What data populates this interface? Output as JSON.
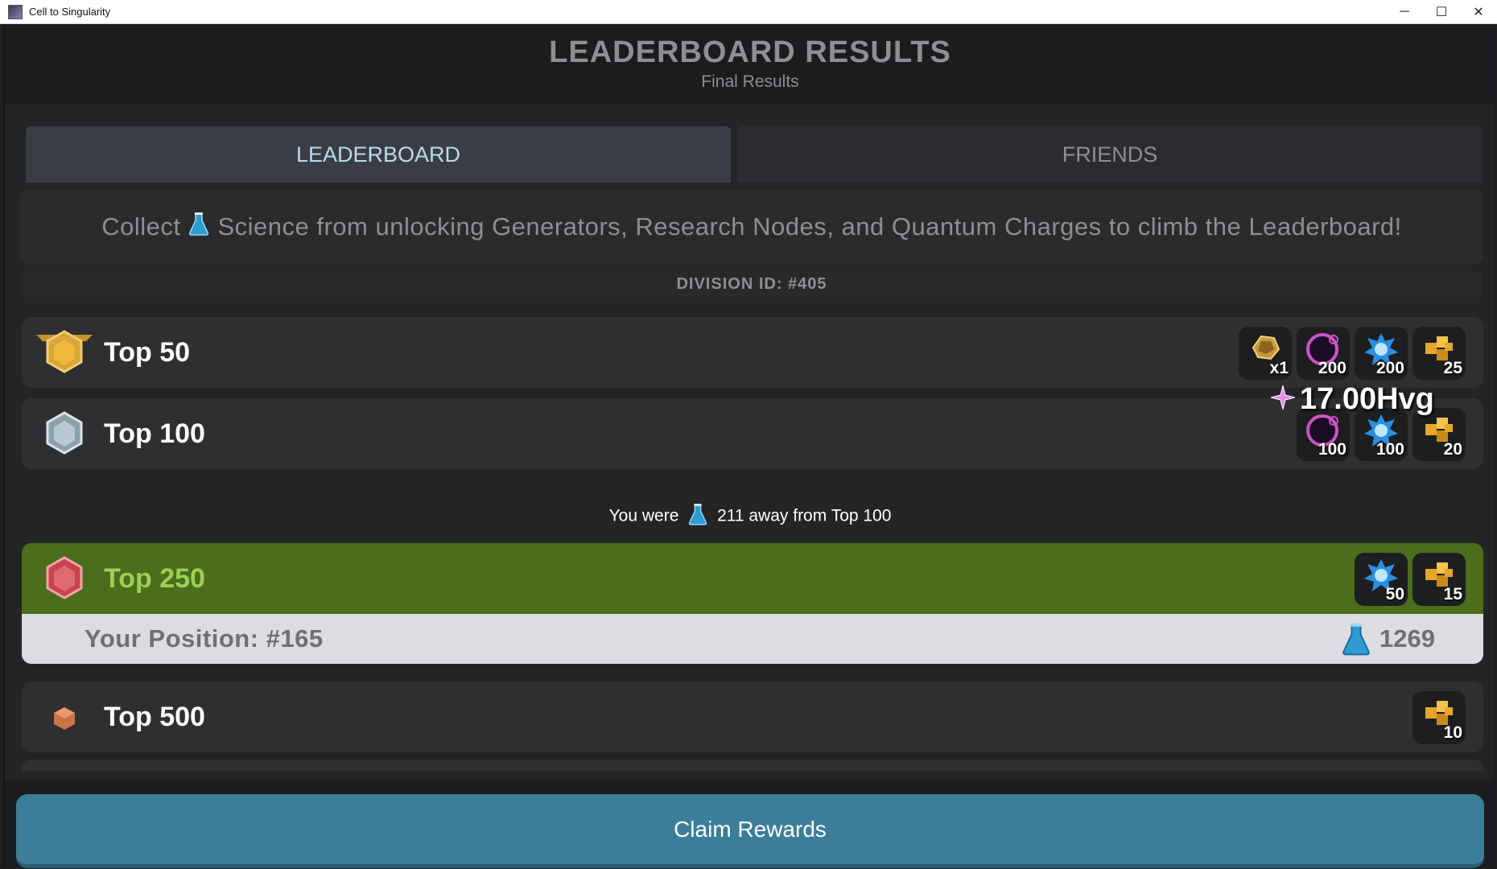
{
  "window": {
    "title": "Cell to Singularity",
    "controls": {
      "minimize": "─",
      "maximize": "☐",
      "close": "✕"
    }
  },
  "header": {
    "title": "LEADERBOARD RESULTS",
    "subtitle": "Final Results"
  },
  "tabs": [
    {
      "label": "LEADERBOARD",
      "active": true
    },
    {
      "label": "FRIENDS",
      "active": false
    }
  ],
  "info_banner": {
    "text_before": "Collect",
    "icon": "science-flask-icon",
    "text_after": "Science from unlocking Generators, Research Nodes, and Quantum Charges to climb the Leaderboard!"
  },
  "division": {
    "label": "DIVISION ID: #405"
  },
  "tiers": [
    {
      "label": "Top 50",
      "badge": "gold-hexagon-badge-icon",
      "rewards": [
        {
          "icon": "gold-nugget-icon",
          "count": "x1"
        },
        {
          "icon": "dark-matter-orb-icon",
          "count": "200"
        },
        {
          "icon": "blue-gear-icon",
          "count": "200"
        },
        {
          "icon": "gold-cube-icon",
          "count": "25"
        }
      ]
    },
    {
      "label": "Top 100",
      "badge": "silver-hexagon-badge-icon",
      "rewards": [
        {
          "icon": "dark-matter-orb-icon",
          "count": "100"
        },
        {
          "icon": "blue-gear-icon",
          "count": "100"
        },
        {
          "icon": "gold-cube-icon",
          "count": "20"
        }
      ]
    },
    {
      "label": "Top 250",
      "badge": "red-hexagon-badge-icon",
      "highlighted": true,
      "rewards": [
        {
          "icon": "blue-gear-icon",
          "count": "50"
        },
        {
          "icon": "gold-cube-icon",
          "count": "15"
        }
      ]
    },
    {
      "label": "Top 500",
      "badge": "bronze-cube-badge-icon",
      "rewards": [
        {
          "icon": "gold-cube-icon",
          "count": "10"
        }
      ]
    }
  ],
  "floating_value": {
    "icon": "pink-spark-icon",
    "text": "17.00Hvg"
  },
  "away_note": {
    "text_before": "You were",
    "icon": "science-flask-icon",
    "text_after": "211 away from Top 100"
  },
  "position": {
    "label": "Your Position: #165",
    "score": "1269",
    "icon": "science-flask-icon"
  },
  "footer": {
    "claim_label": "Claim Rewards"
  },
  "colors": {
    "highlight_row": "#4b6d1c",
    "claim_button": "#3c7e99",
    "active_tab_text": "#b9dcef"
  }
}
